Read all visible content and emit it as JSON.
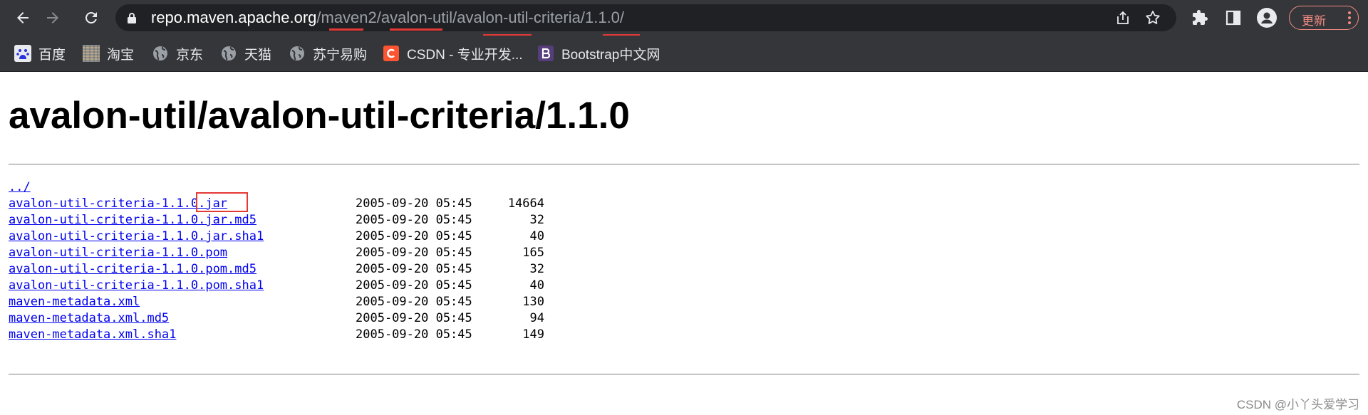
{
  "browser": {
    "url_host": "repo.maven.apache.org",
    "url_path": "/maven2/avalon-util/avalon-util-criteria/1.1.0/",
    "update_label": "更新",
    "accent_color": "#f28b82"
  },
  "bookmarks": [
    {
      "label": "百度",
      "icon": "baidu-icon"
    },
    {
      "label": "淘宝",
      "icon": "taobao-icon"
    },
    {
      "label": "京东",
      "icon": "globe-icon"
    },
    {
      "label": "天猫",
      "icon": "globe-icon"
    },
    {
      "label": "苏宁易购",
      "icon": "globe-icon"
    },
    {
      "label": "CSDN - 专业开发...",
      "icon": "csdn-icon"
    },
    {
      "label": "Bootstrap中文网",
      "icon": "bootstrap-icon"
    }
  ],
  "page": {
    "title": "avalon-util/avalon-util-criteria/1.1.0",
    "parent_link": "../",
    "files": [
      {
        "name": "avalon-util-criteria-1.1.0.jar",
        "date": "2005-09-20 05:45",
        "size": "14664"
      },
      {
        "name": "avalon-util-criteria-1.1.0.jar.md5",
        "date": "2005-09-20 05:45",
        "size": "32"
      },
      {
        "name": "avalon-util-criteria-1.1.0.jar.sha1",
        "date": "2005-09-20 05:45",
        "size": "40"
      },
      {
        "name": "avalon-util-criteria-1.1.0.pom",
        "date": "2005-09-20 05:45",
        "size": "165"
      },
      {
        "name": "avalon-util-criteria-1.1.0.pom.md5",
        "date": "2005-09-20 05:45",
        "size": "32"
      },
      {
        "name": "avalon-util-criteria-1.1.0.pom.sha1",
        "date": "2005-09-20 05:45",
        "size": "40"
      },
      {
        "name": "maven-metadata.xml",
        "date": "2005-09-20 05:45",
        "size": "130"
      },
      {
        "name": "maven-metadata.xml.md5",
        "date": "2005-09-20 05:45",
        "size": "94"
      },
      {
        "name": "maven-metadata.xml.sha1",
        "date": "2005-09-20 05:45",
        "size": "149"
      }
    ]
  },
  "watermark": "CSDN @小丫头爱学习"
}
